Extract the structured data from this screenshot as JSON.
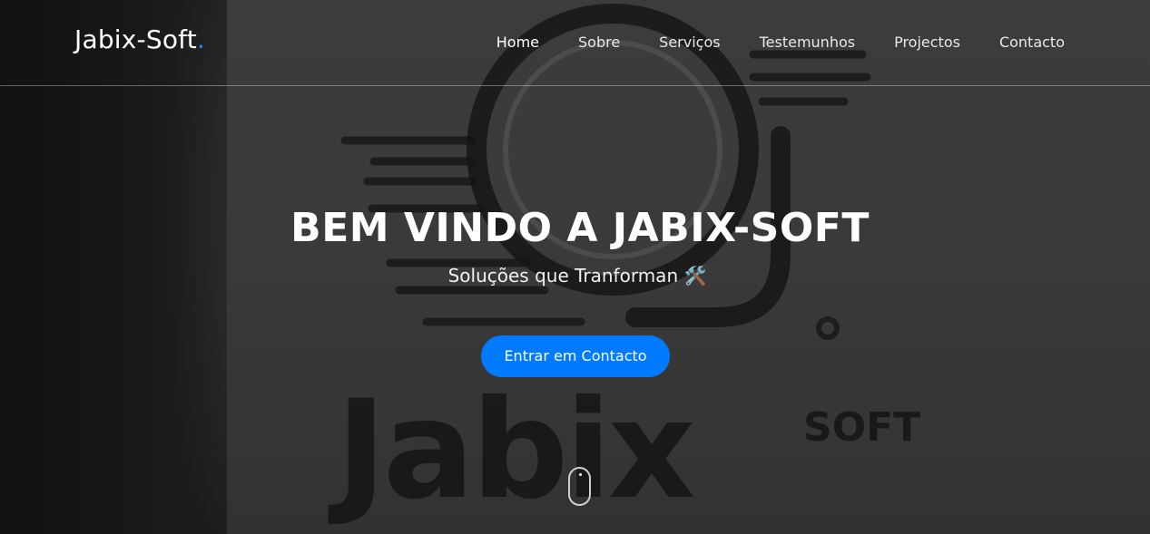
{
  "brand": {
    "name": "Jabix-Soft",
    "dot": "."
  },
  "nav": {
    "items": [
      {
        "label": "Home",
        "active": true
      },
      {
        "label": "Sobre",
        "active": false
      },
      {
        "label": "Serviços",
        "active": false
      },
      {
        "label": "Testemunhos",
        "active": false
      },
      {
        "label": "Projectos",
        "active": false
      },
      {
        "label": "Contacto",
        "active": false
      }
    ]
  },
  "hero": {
    "title": "BEM VINDO A JABIX-SOFT",
    "subtitle": "Soluções que Tranforman 🛠️",
    "cta_label": "Entrar em Contacto"
  },
  "colors": {
    "accent": "#007bff",
    "brand_dot": "#1e88ff",
    "text": "#ffffff"
  },
  "icons": {
    "scroll": "mouse-scroll-icon",
    "subtitle_emoji": "tools-emoji"
  }
}
